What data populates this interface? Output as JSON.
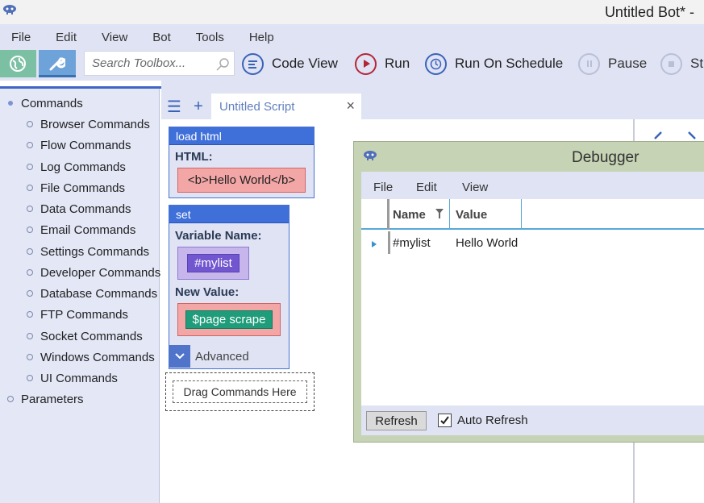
{
  "window": {
    "title": "Untitled Bot* -"
  },
  "menu": {
    "items": [
      "File",
      "Edit",
      "View",
      "Bot",
      "Tools",
      "Help"
    ]
  },
  "toolbar": {
    "search_placeholder": "Search Toolbox...",
    "actions": [
      {
        "label": "Code View",
        "icon": "code-view-icon",
        "color": "#3a63b8"
      },
      {
        "label": "Run",
        "icon": "run-icon",
        "color": "#b3263a"
      },
      {
        "label": "Run On Schedule",
        "icon": "schedule-icon",
        "color": "#3a63b8"
      },
      {
        "label": "Pause",
        "icon": "pause-icon",
        "color": "#b8c0d8"
      },
      {
        "label": "St",
        "icon": "stop-icon",
        "color": "#b8c0d8"
      }
    ]
  },
  "sidebar": {
    "root_label": "Commands",
    "items": [
      "Browser Commands",
      "Flow Commands",
      "Log Commands",
      "File Commands",
      "Data Commands",
      "Email Commands",
      "Settings Commands",
      "Developer Commands",
      "Database Commands",
      "FTP Commands",
      "Socket Commands",
      "Windows Commands",
      "UI Commands"
    ],
    "parameters_label": "Parameters"
  },
  "workspace": {
    "tab_label": "Untitled Script",
    "close_glyph": "×",
    "menu_glyph": "☰",
    "add_glyph": "+",
    "blocks": {
      "load_html": {
        "title": "load html",
        "field_label": "HTML:",
        "value": "<b>Hello World</b>"
      },
      "set": {
        "title": "set",
        "var_label": "Variable Name:",
        "var_value": "#mylist",
        "value_label": "New Value:",
        "value_value": "$page scrape",
        "advanced_label": "Advanced"
      }
    },
    "drop_zone_label": "Drag Commands Here"
  },
  "debugger": {
    "title": "Debugger",
    "menu": [
      "File",
      "Edit",
      "View"
    ],
    "columns": [
      "Name",
      "Value"
    ],
    "rows": [
      {
        "name": "#mylist",
        "value": "Hello World"
      }
    ],
    "refresh_label": "Refresh",
    "auto_refresh_label": "Auto Refresh",
    "auto_refresh_checked": true
  },
  "colors": {
    "accent": "#3f6fd8",
    "debugger_frame": "#c6d3b4",
    "band": "#dfe3f3"
  }
}
